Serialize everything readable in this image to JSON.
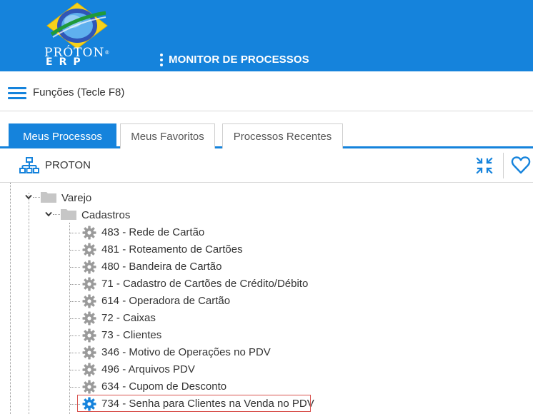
{
  "header": {
    "logo_name": "PRÓTON",
    "logo_reg": "®",
    "logo_sub": "ERP",
    "menu_icon": "kebab-icon",
    "title": "MONITOR DE PROCESSOS",
    "color": "#1583dc"
  },
  "funcbar": {
    "menu_icon": "hamburger-icon",
    "label": "Funções (Tecle F8)"
  },
  "tabs": [
    {
      "label": "Meus Processos",
      "active": true
    },
    {
      "label": "Meus Favoritos",
      "active": false
    },
    {
      "label": "Processos Recentes",
      "active": false
    }
  ],
  "treehead": {
    "root_icon": "org-chart-icon",
    "root_label": "PROTON",
    "collapse_icon": "collapse-arrows-icon",
    "favorite_icon": "heart-icon"
  },
  "tree": {
    "folders": [
      {
        "label": "Varejo",
        "expanded": true
      },
      {
        "label": "Cadastros",
        "expanded": true
      }
    ],
    "items": [
      {
        "label": "483 - Rede de Cartão",
        "icon": "gear-icon"
      },
      {
        "label": "481 - Roteamento de Cartões",
        "icon": "gear-icon"
      },
      {
        "label": "480 - Bandeira de Cartão",
        "icon": "gear-icon"
      },
      {
        "label": "71 - Cadastro de Cartões de Crédito/Débito",
        "icon": "gear-icon"
      },
      {
        "label": "614 - Operadora de Cartão",
        "icon": "gear-icon"
      },
      {
        "label": "72 - Caixas",
        "icon": "gear-icon"
      },
      {
        "label": "73 - Clientes",
        "icon": "gear-icon"
      },
      {
        "label": "346 - Motivo de Operações no PDV",
        "icon": "gear-icon"
      },
      {
        "label": "496 - Arquivos PDV",
        "icon": "gear-icon"
      },
      {
        "label": "634 - Cupom de Desconto",
        "icon": "gear-icon"
      },
      {
        "label": "734 - Senha para Clientes na Venda no PDV",
        "icon": "gear-icon",
        "selected": true
      }
    ],
    "gear_color": "#9a9a9a",
    "selected_gear_color": "#1583dc",
    "highlight_color": "#d9534f"
  }
}
